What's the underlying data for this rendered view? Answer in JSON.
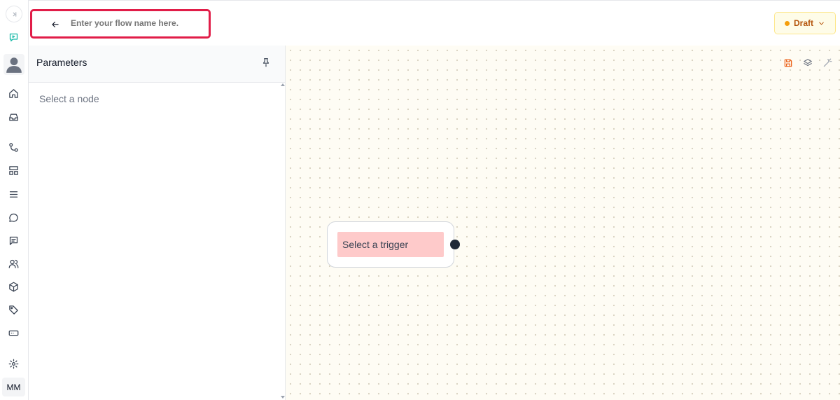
{
  "header": {
    "flow_name_placeholder": "Enter your flow name here.",
    "status": "Draft",
    "status_color": "#f59e0b"
  },
  "sidebar": {
    "user_initials": "MM",
    "items": [
      {
        "name": "home",
        "icon": "home-icon"
      },
      {
        "name": "inbox",
        "icon": "inbox-icon"
      },
      {
        "name": "flows",
        "icon": "workflow-icon"
      },
      {
        "name": "templates",
        "icon": "layout-icon"
      },
      {
        "name": "lists",
        "icon": "list-icon"
      },
      {
        "name": "conversations",
        "icon": "chat-icon"
      },
      {
        "name": "messages",
        "icon": "message-square-icon"
      },
      {
        "name": "contacts",
        "icon": "users-icon"
      },
      {
        "name": "products",
        "icon": "package-icon"
      },
      {
        "name": "tags",
        "icon": "tag-icon"
      },
      {
        "name": "inputs",
        "icon": "input-icon"
      },
      {
        "name": "settings",
        "icon": "gear-icon"
      }
    ]
  },
  "panel": {
    "title": "Parameters",
    "empty_text": "Select a node"
  },
  "canvas": {
    "trigger_node_label": "Select a trigger",
    "tool_icons": [
      "save-icon",
      "layers-icon",
      "wand-icon"
    ],
    "accent_color": "#ea580c"
  }
}
